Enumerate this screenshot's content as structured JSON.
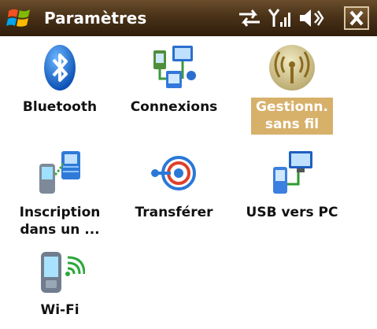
{
  "title_bar": {
    "title": "Paramètres",
    "start_icon": "windows-flag-icon",
    "status_icons": [
      "connectivity-arrows-icon",
      "signal-strength-icon",
      "volume-icon"
    ],
    "close_icon": "close-x-icon"
  },
  "items": [
    {
      "label": "Bluetooth",
      "icon": "bluetooth-icon",
      "selected": false
    },
    {
      "label": "Connexions",
      "icon": "connections-icon",
      "selected": false
    },
    {
      "label": "Gestionn.\nsans fil",
      "icon": "wireless-manager-icon",
      "selected": true
    },
    {
      "label": "Inscription\ndans un ...",
      "icon": "domain-enroll-icon",
      "selected": false
    },
    {
      "label": "Transférer",
      "icon": "beam-icon",
      "selected": false
    },
    {
      "label": "USB vers PC",
      "icon": "usb-to-pc-icon",
      "selected": false
    },
    {
      "label": "Wi-Fi",
      "icon": "wifi-icon",
      "selected": false
    }
  ],
  "colors": {
    "title_bar": "#4a3218",
    "selection": "#d7b06a"
  }
}
